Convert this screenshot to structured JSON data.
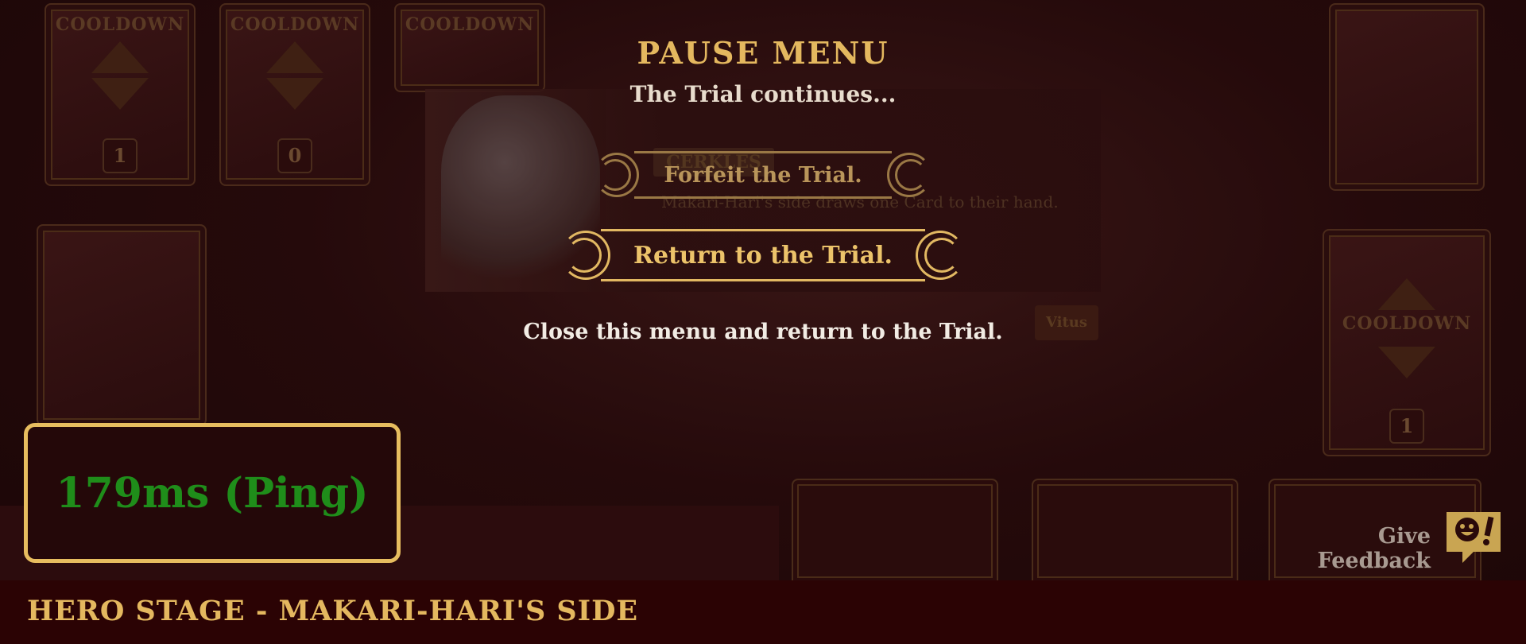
{
  "pause_menu": {
    "title": "PAUSE MENU",
    "subtitle": "The Trial continues...",
    "forfeit_label": "Forfeit the Trial.",
    "return_label": "Return to the Trial.",
    "hint": "Close this menu and return to the Trial."
  },
  "background": {
    "cooldown_cards": [
      {
        "label": "COOLDOWN",
        "count": "1"
      },
      {
        "label": "COOLDOWN",
        "count": "0"
      },
      {
        "label": "COOLDOWN",
        "count": ""
      },
      {
        "label": "COOLDOWN",
        "count": "1"
      }
    ],
    "panel_tag": "CERKLES",
    "panel_desc": "Makari-Hari's side draws one Card to their hand.",
    "panel_button": "Vitus"
  },
  "ping": {
    "text": "179ms (Ping)"
  },
  "feedback": {
    "label": "Give Feedback",
    "icon": "feedback-face-icon"
  },
  "status_bar": {
    "stage": "HERO STAGE - MAKARI-HARI'S SIDE"
  },
  "colors": {
    "gold": "#e4b85f",
    "ping_green": "#1f8d1a",
    "bar_red": "#2b0304",
    "overlay": "#1e0708"
  }
}
